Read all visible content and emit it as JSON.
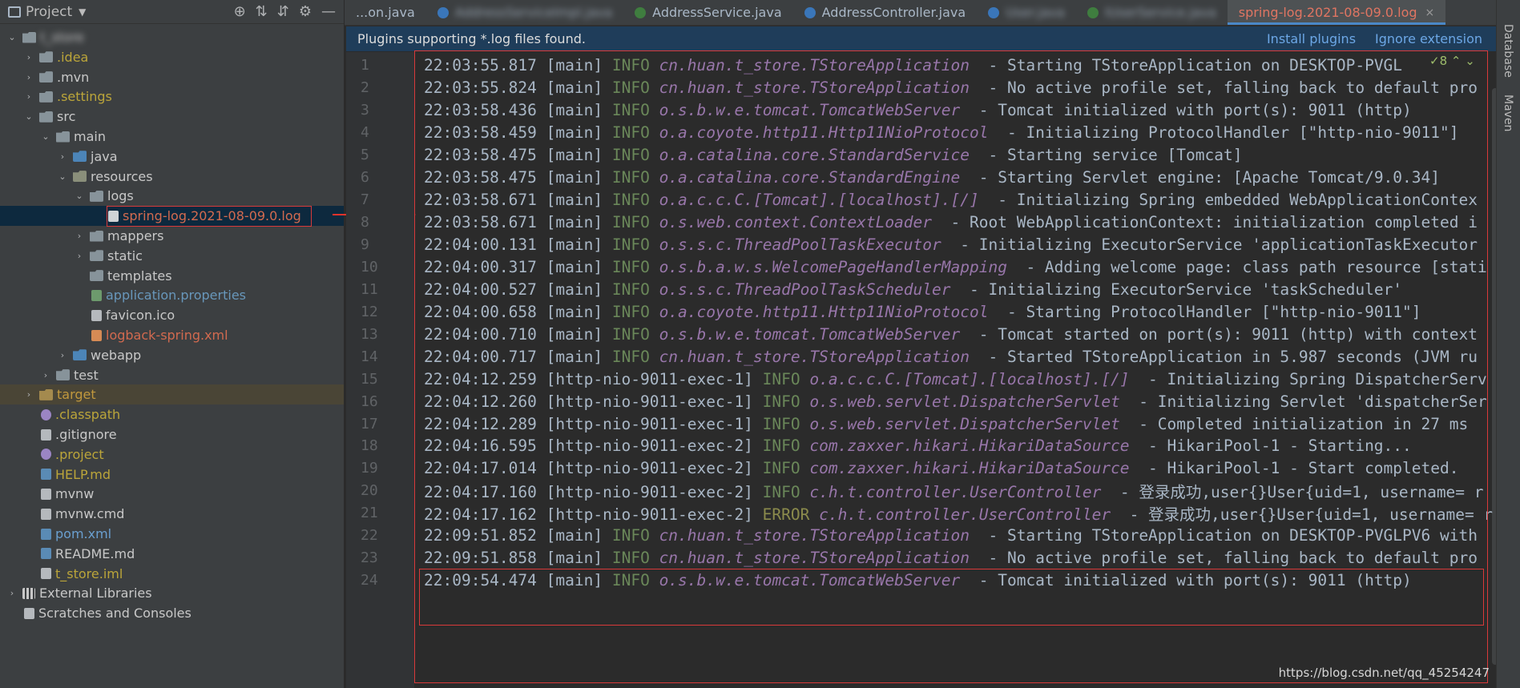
{
  "sidebar": {
    "title": "Project",
    "tools": [
      "⊕",
      "⇅",
      "⇵",
      "⚙",
      "—"
    ],
    "tree": [
      {
        "label": "t_store",
        "indent": 0,
        "arrow": "⌄",
        "icon": "folder",
        "color": "wh",
        "blur": true
      },
      {
        "label": ".idea",
        "indent": 1,
        "arrow": "›",
        "icon": "folder",
        "color": "yel"
      },
      {
        "label": ".mvn",
        "indent": 1,
        "arrow": "›",
        "icon": "folder",
        "color": "wh"
      },
      {
        "label": ".settings",
        "indent": 1,
        "arrow": "›",
        "icon": "folder",
        "color": "yel"
      },
      {
        "label": "src",
        "indent": 1,
        "arrow": "⌄",
        "icon": "folder",
        "color": "wh"
      },
      {
        "label": "main",
        "indent": 2,
        "arrow": "⌄",
        "icon": "folder",
        "color": "wh"
      },
      {
        "label": "java",
        "indent": 3,
        "arrow": "›",
        "icon": "folder blue",
        "color": "wh"
      },
      {
        "label": "resources",
        "indent": 3,
        "arrow": "⌄",
        "icon": "folder res",
        "color": "wh"
      },
      {
        "label": "logs",
        "indent": 4,
        "arrow": "⌄",
        "icon": "folder",
        "color": "wh"
      },
      {
        "label": "spring-log.2021-08-09.0.log",
        "indent": 5,
        "arrow": "",
        "icon": "file log",
        "color": "red",
        "sel": true
      },
      {
        "label": "mappers",
        "indent": 4,
        "arrow": "›",
        "icon": "folder",
        "color": "wh"
      },
      {
        "label": "static",
        "indent": 4,
        "arrow": "›",
        "icon": "folder",
        "color": "wh"
      },
      {
        "label": "templates",
        "indent": 4,
        "arrow": "",
        "icon": "folder",
        "color": "wh"
      },
      {
        "label": "application.properties",
        "indent": 4,
        "arrow": "",
        "icon": "file prop",
        "color": "blue"
      },
      {
        "label": "favicon.ico",
        "indent": 4,
        "arrow": "",
        "icon": "file",
        "color": "wh"
      },
      {
        "label": "logback-spring.xml",
        "indent": 4,
        "arrow": "",
        "icon": "file xml",
        "color": "red"
      },
      {
        "label": "webapp",
        "indent": 3,
        "arrow": "›",
        "icon": "folder blue",
        "color": "wh"
      },
      {
        "label": "test",
        "indent": 2,
        "arrow": "›",
        "icon": "folder",
        "color": "wh"
      },
      {
        "label": "target",
        "indent": 1,
        "arrow": "›",
        "icon": "folder yel",
        "color": "gold",
        "excl": true
      },
      {
        "label": ".classpath",
        "indent": 1,
        "arrow": "",
        "icon": "file cls",
        "color": "yel"
      },
      {
        "label": ".gitignore",
        "indent": 1,
        "arrow": "",
        "icon": "file",
        "color": "wh"
      },
      {
        "label": ".project",
        "indent": 1,
        "arrow": "",
        "icon": "file cls",
        "color": "yel"
      },
      {
        "label": "HELP.md",
        "indent": 1,
        "arrow": "",
        "icon": "file md",
        "color": "yel"
      },
      {
        "label": "mvnw",
        "indent": 1,
        "arrow": "",
        "icon": "file",
        "color": "wh"
      },
      {
        "label": "mvnw.cmd",
        "indent": 1,
        "arrow": "",
        "icon": "file",
        "color": "wh"
      },
      {
        "label": "pom.xml",
        "indent": 1,
        "arrow": "",
        "icon": "file md",
        "color": "blue2"
      },
      {
        "label": "README.md",
        "indent": 1,
        "arrow": "",
        "icon": "file md",
        "color": "wh"
      },
      {
        "label": "t_store.iml",
        "indent": 1,
        "arrow": "",
        "icon": "file",
        "color": "yel"
      },
      {
        "label": "External Libraries",
        "indent": 0,
        "arrow": "›",
        "icon": "lib",
        "color": "wh"
      },
      {
        "label": "Scratches and Consoles",
        "indent": 0,
        "arrow": "",
        "icon": "file",
        "color": "wh"
      }
    ]
  },
  "tabs": [
    {
      "label": "...on.java",
      "icon": "",
      "blur": false
    },
    {
      "label": "AddressServiceImpl.java",
      "icon": "b",
      "blur": true
    },
    {
      "label": "AddressService.java",
      "icon": "g",
      "blur": false
    },
    {
      "label": "AddressController.java",
      "icon": "b",
      "blur": false
    },
    {
      "label": "User.java",
      "icon": "b",
      "blur": true
    },
    {
      "label": "IUserService.java",
      "icon": "g",
      "blur": true
    },
    {
      "label": "spring-log.2021-08-09.0.log",
      "icon": "",
      "blur": false,
      "active": true
    }
  ],
  "tab_overflow": "⌄",
  "banner": {
    "message": "Plugins supporting *.log files found.",
    "install": "Install plugins",
    "ignore": "Ignore extension"
  },
  "right_strip": [
    "Database",
    "Maven"
  ],
  "inspection": "✓8 ⌃ ⌄",
  "watermark": "https://blog.csdn.net/qq_45254247",
  "log_lines": [
    {
      "n": "1",
      "t": "22:03:55.817",
      "th": "[main]",
      "lv": "INFO",
      "c": "cn.huan.t_store.TStoreApplication",
      "m": " - Starting TStoreApplication on DESKTOP-PVGL"
    },
    {
      "n": "2",
      "t": "22:03:55.824",
      "th": "[main]",
      "lv": "INFO",
      "c": "cn.huan.t_store.TStoreApplication",
      "m": " - No active profile set, falling back to default pro"
    },
    {
      "n": "3",
      "t": "22:03:58.436",
      "th": "[main]",
      "lv": "INFO",
      "c": "o.s.b.w.e.tomcat.TomcatWebServer",
      "m": " - Tomcat initialized with port(s): 9011 (http)"
    },
    {
      "n": "4",
      "t": "22:03:58.459",
      "th": "[main]",
      "lv": "INFO",
      "c": "o.a.coyote.http11.Http11NioProtocol",
      "m": " - Initializing ProtocolHandler [\"http-nio-9011\"]"
    },
    {
      "n": "5",
      "t": "22:03:58.475",
      "th": "[main]",
      "lv": "INFO",
      "c": "o.a.catalina.core.StandardService",
      "m": " - Starting service [Tomcat]"
    },
    {
      "n": "6",
      "t": "22:03:58.475",
      "th": "[main]",
      "lv": "INFO",
      "c": "o.a.catalina.core.StandardEngine",
      "m": " - Starting Servlet engine: [Apache Tomcat/9.0.34]"
    },
    {
      "n": "7",
      "t": "22:03:58.671",
      "th": "[main]",
      "lv": "INFO",
      "c": "o.a.c.c.C.[Tomcat].[localhost].[/]",
      "m": " - Initializing Spring embedded WebApplicationContex"
    },
    {
      "n": "8",
      "t": "22:03:58.671",
      "th": "[main]",
      "lv": "INFO",
      "c": "o.s.web.context.ContextLoader",
      "m": " - Root WebApplicationContext: initialization completed i"
    },
    {
      "n": "9",
      "t": "22:04:00.131",
      "th": "[main]",
      "lv": "INFO",
      "c": "o.s.s.c.ThreadPoolTaskExecutor",
      "m": " - Initializing ExecutorService 'applicationTaskExecutor"
    },
    {
      "n": "10",
      "t": "22:04:00.317",
      "th": "[main]",
      "lv": "INFO",
      "c": "o.s.b.a.w.s.WelcomePageHandlerMapping",
      "m": " - Adding welcome page: class path resource [stati"
    },
    {
      "n": "11",
      "t": "22:04:00.527",
      "th": "[main]",
      "lv": "INFO",
      "c": "o.s.s.c.ThreadPoolTaskScheduler",
      "m": " - Initializing ExecutorService 'taskScheduler'"
    },
    {
      "n": "12",
      "t": "22:04:00.658",
      "th": "[main]",
      "lv": "INFO",
      "c": "o.a.coyote.http11.Http11NioProtocol",
      "m": " - Starting ProtocolHandler [\"http-nio-9011\"]"
    },
    {
      "n": "13",
      "t": "22:04:00.710",
      "th": "[main]",
      "lv": "INFO",
      "c": "o.s.b.w.e.tomcat.TomcatWebServer",
      "m": " - Tomcat started on port(s): 9011 (http) with context"
    },
    {
      "n": "14",
      "t": "22:04:00.717",
      "th": "[main]",
      "lv": "INFO",
      "c": "cn.huan.t_store.TStoreApplication",
      "m": " - Started TStoreApplication in 5.987 seconds (JVM ru"
    },
    {
      "n": "15",
      "t": "22:04:12.259",
      "th": "[http-nio-9011-exec-1]",
      "lv": "INFO",
      "c": "o.a.c.c.C.[Tomcat].[localhost].[/]",
      "m": " - Initializing Spring DispatcherServ"
    },
    {
      "n": "16",
      "t": "22:04:12.260",
      "th": "[http-nio-9011-exec-1]",
      "lv": "INFO",
      "c": "o.s.web.servlet.DispatcherServlet",
      "m": " - Initializing Servlet 'dispatcherSer"
    },
    {
      "n": "17",
      "t": "22:04:12.289",
      "th": "[http-nio-9011-exec-1]",
      "lv": "INFO",
      "c": "o.s.web.servlet.DispatcherServlet",
      "m": " - Completed initialization in 27 ms"
    },
    {
      "n": "18",
      "t": "22:04:16.595",
      "th": "[http-nio-9011-exec-2]",
      "lv": "INFO",
      "c": "com.zaxxer.hikari.HikariDataSource",
      "m": " - HikariPool-1 - Starting..."
    },
    {
      "n": "19",
      "t": "22:04:17.014",
      "th": "[http-nio-9011-exec-2]",
      "lv": "INFO",
      "c": "com.zaxxer.hikari.HikariDataSource",
      "m": " - HikariPool-1 - Start completed."
    },
    {
      "n": "20",
      "t": "22:04:17.160",
      "th": "[http-nio-9011-exec-2]",
      "lv": "INFO",
      "c": "c.h.t.controller.UserController",
      "m": " - 登录成功,user{}User{uid=1, username= r"
    },
    {
      "n": "21",
      "t": "22:04:17.162",
      "th": "[http-nio-9011-exec-2]",
      "lv": "ERROR",
      "c": "c.h.t.controller.UserController",
      "m": " - 登录成功,user{}User{uid=1, username= r"
    },
    {
      "n": "22",
      "t": "22:09:51.852",
      "th": "[main]",
      "lv": "INFO",
      "c": "cn.huan.t_store.TStoreApplication",
      "m": " - Starting TStoreApplication on DESKTOP-PVGLPV6 with"
    },
    {
      "n": "23",
      "t": "22:09:51.858",
      "th": "[main]",
      "lv": "INFO",
      "c": "cn.huan.t_store.TStoreApplication",
      "m": " - No active profile set, falling back to default pro"
    },
    {
      "n": "24",
      "t": "22:09:54.474",
      "th": "[main]",
      "lv": "INFO",
      "c": "o.s.b.w.e.tomcat.TomcatWebServer",
      "m": " - Tomcat initialized with port(s): 9011 (http)"
    }
  ]
}
